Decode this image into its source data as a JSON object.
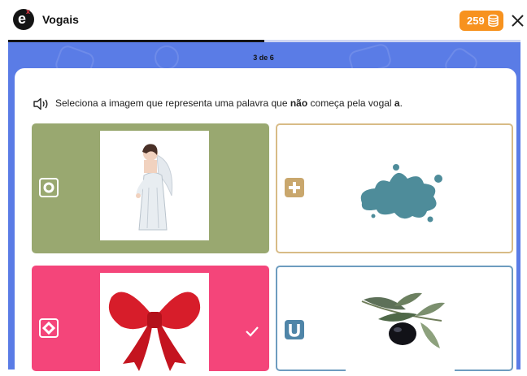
{
  "header": {
    "app_title": "Vogais",
    "logo_icon": "e-logo-icon",
    "coins": "259",
    "coin_icon": "coin-stack-icon",
    "close_icon": "close-icon",
    "brand_color": "#f7921e"
  },
  "progress": {
    "step_text": "3 de 6",
    "fraction": 0.5
  },
  "question": {
    "speaker_icon": "speaker-icon",
    "text_before": "Seleciona a imagem que representa uma palavra que ",
    "bold_word": "não",
    "text_middle": " começa pela vogal ",
    "bold_letter": "a",
    "text_end": "."
  },
  "options": [
    {
      "symbol_icon": "circle-symbol-icon",
      "image": "angel-image",
      "background": "#99a870",
      "selected": false
    },
    {
      "symbol_icon": "plus-symbol-icon",
      "image": "water-splash-image",
      "background": "#ffffff",
      "selected": false
    },
    {
      "symbol_icon": "diamond-symbol-icon",
      "image": "red-bow-image",
      "background": "#f4457a",
      "selected": true,
      "check_icon": "check-icon"
    },
    {
      "symbol_icon": "u-symbol-icon",
      "image": "olive-image",
      "background": "#ffffff",
      "selected": false
    }
  ]
}
